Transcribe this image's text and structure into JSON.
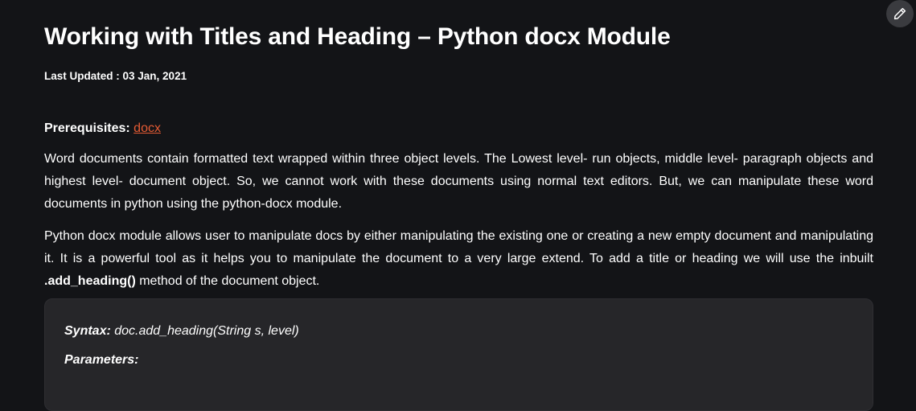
{
  "article": {
    "title": "Working with Titles and Heading – Python docx Module",
    "last_updated_label": "Last Updated : ",
    "last_updated_date": "03 Jan, 2021",
    "prerequisites_label": "Prerequisites:",
    "prerequisites_link": "docx",
    "paragraph1": "Word documents contain formatted text wrapped within three object levels. The Lowest level- run objects, middle level- paragraph objects and highest level- document object. So, we cannot work with these documents using normal text editors. But, we can manipulate these word documents in python using the python-docx module.",
    "paragraph2_before": "Python docx module allows user to manipulate docs by either manipulating the existing one or creating a new empty document and manipulating it. It is a powerful tool as it helps you to manipulate the document to a very large extend. To add a title or heading we will use the inbuilt ",
    "paragraph2_method": ".add_heading()",
    "paragraph2_after": " method of the document object."
  },
  "syntax_box": {
    "syntax_label": "Syntax:",
    "syntax_text": " doc.add_heading(String s, level)",
    "parameters_label": "Parameters:"
  },
  "edit_button": {
    "icon": "pencil-icon"
  },
  "colors": {
    "background": "#131417",
    "link": "#e45b34",
    "code_box": "#262629"
  }
}
